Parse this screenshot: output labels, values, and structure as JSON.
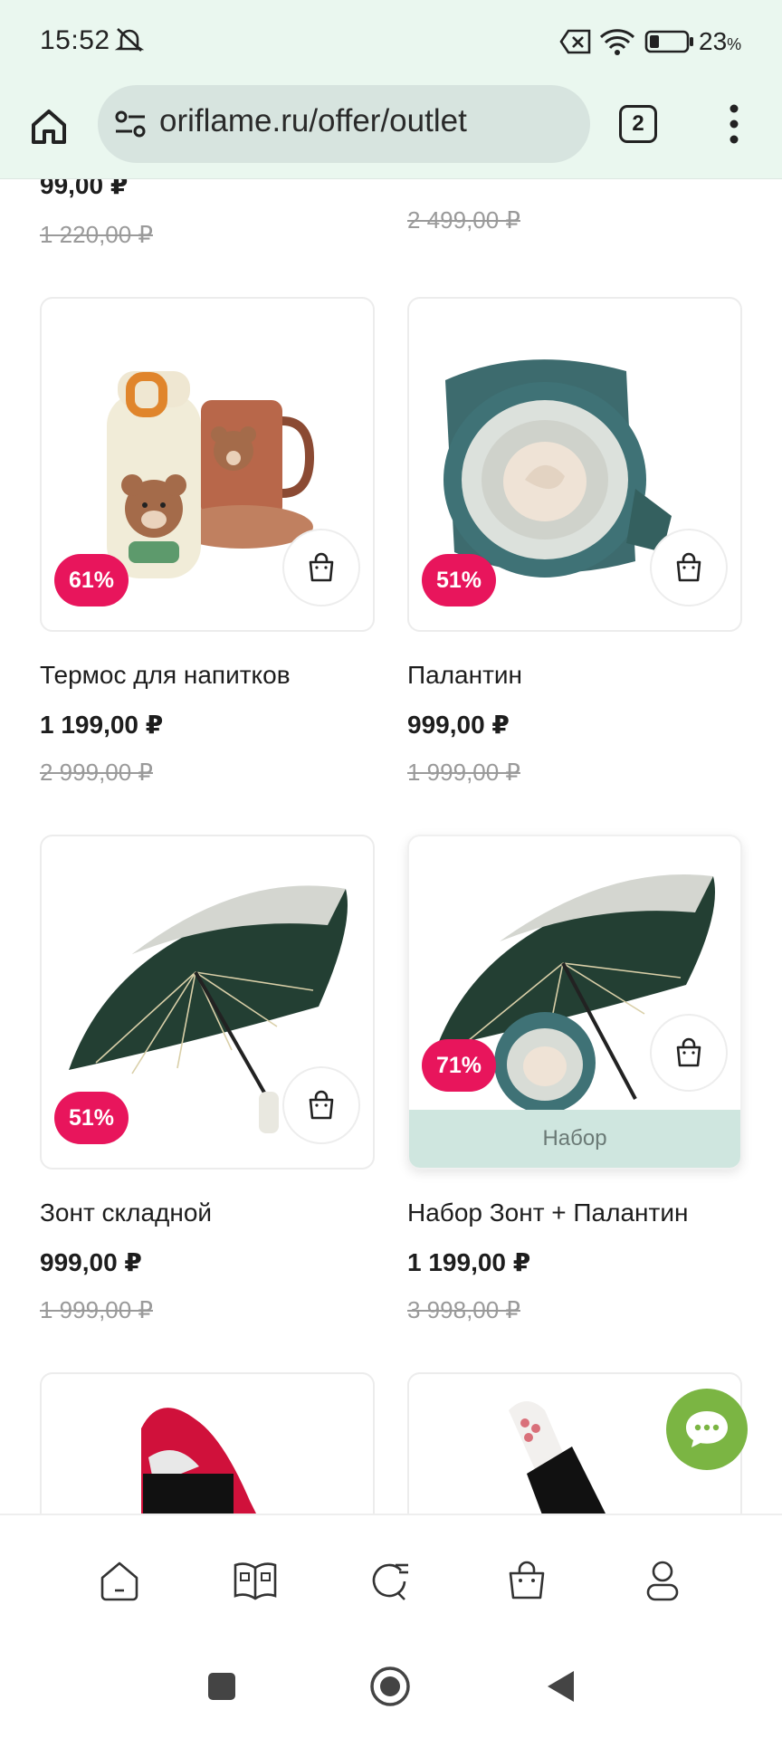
{
  "status_bar": {
    "time": "15:52",
    "battery": "23",
    "battery_unit": "%"
  },
  "browser": {
    "url": "oriflame.ru/offer/outlet",
    "tab_count": "2"
  },
  "top_partial": {
    "left": {
      "price": "99,00 ₽",
      "old_price": "1 220,00 ₽"
    },
    "right": {
      "old_price": "2 499,00 ₽"
    }
  },
  "products": [
    {
      "title": "Термос для напитков",
      "price": "1 199,00 ₽",
      "old_price": "2 999,00 ₽",
      "discount": "61%",
      "image": "thermos-bear-set"
    },
    {
      "title": "Палантин",
      "price": "999,00 ₽",
      "old_price": "1 999,00 ₽",
      "discount": "51%",
      "image": "rolled-scarf"
    },
    {
      "title": "Зонт складной",
      "price": "999,00 ₽",
      "old_price": "1 999,00 ₽",
      "discount": "51%",
      "image": "folding-umbrella"
    },
    {
      "title": "Набор Зонт + Палантин",
      "price": "1 199,00 ₽",
      "old_price": "3 998,00 ₽",
      "discount": "71%",
      "image": "umbrella-scarf-set",
      "tag": "Набор"
    }
  ],
  "bottom_nav": [
    "home-icon",
    "catalog-icon",
    "search-icon",
    "cart-icon",
    "profile-icon"
  ],
  "colors": {
    "badge": "#e8155c",
    "chat": "#7bb543",
    "set_strip": "#cfe6df",
    "chrome": "#eaf7ef"
  }
}
